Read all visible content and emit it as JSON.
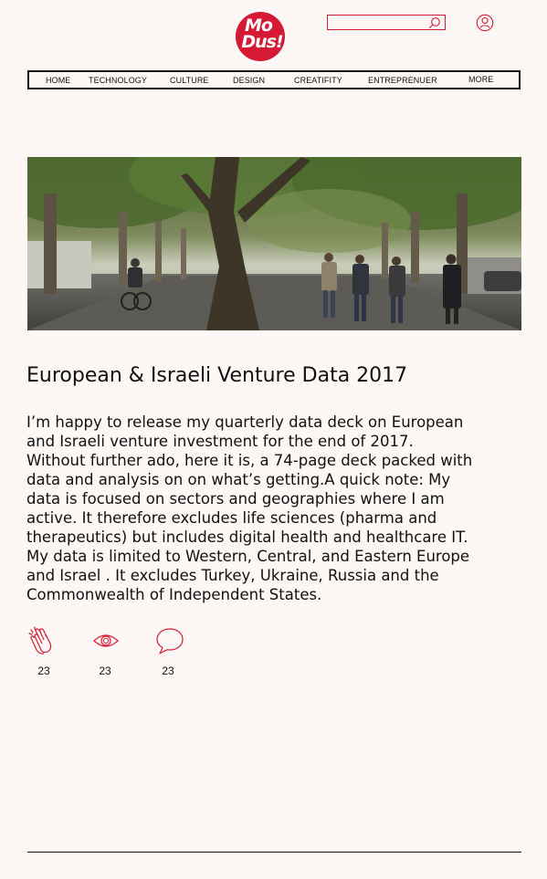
{
  "brand": {
    "logo_line_1": "Mo",
    "logo_line_2": "Dus!",
    "accent_color": "#d51b33"
  },
  "header": {
    "search": {
      "value": "",
      "placeholder": "",
      "icon": "search-icon"
    },
    "account_icon": "user-icon"
  },
  "nav": {
    "items": [
      {
        "label": "HOME"
      },
      {
        "label": "TECHNOLOGY"
      },
      {
        "label": "CULTURE"
      },
      {
        "label": "DESIGN"
      },
      {
        "label": "CREATIFITY"
      },
      {
        "label": "ENTREPRENUER"
      },
      {
        "label": "MORE"
      }
    ]
  },
  "article": {
    "title": "European & Israeli Venture Data 2017",
    "body": "I’m happy to release my quarterly data deck on European and Israeli venture investment for the end of 2017. Without further ado, here it is, a 74-page deck packed with data and analysis on on what’s getting.A quick note: My data is focused on sectors and geographies where I am active. It therefore excludes life sciences (pharma and therapeutics) but includes digital health and healthcare IT. My data is limited to Western, Central, and Eastern Europe and Israel . It excludes Turkey, Ukraine, Russia and the Commonwealth of Independent States.",
    "stats": {
      "claps": {
        "count": "23",
        "icon": "clap-icon"
      },
      "views": {
        "count": "23",
        "icon": "eye-icon"
      },
      "comments": {
        "count": "23",
        "icon": "comment-icon"
      }
    }
  }
}
